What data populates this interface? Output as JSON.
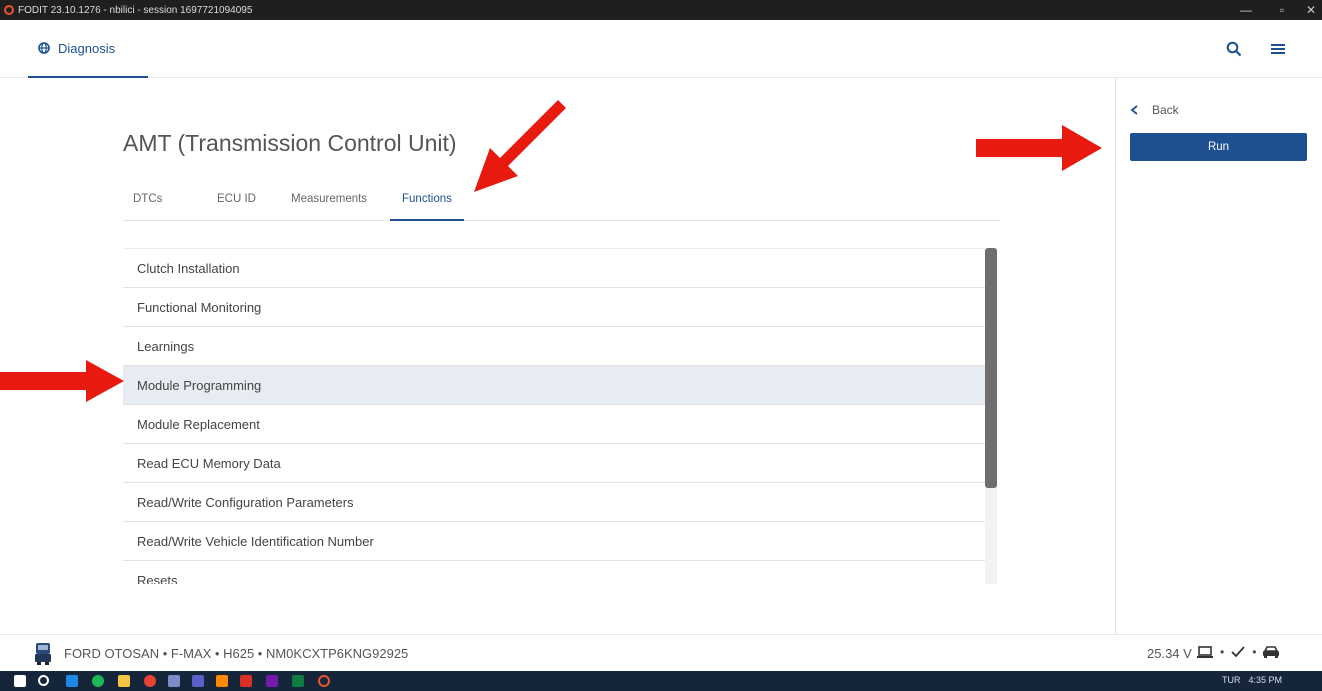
{
  "window": {
    "title": "FODIT 23.10.1276 - nbilici - session 1697721094095",
    "minimize": "—",
    "maximize": "▫",
    "close": "✕"
  },
  "header": {
    "nav_label": "Diagnosis",
    "nav_icon": "globe-icon",
    "search_icon": "search-icon",
    "menu_icon": "hamburger-menu-icon"
  },
  "main": {
    "page_title": "AMT (Transmission Control Unit)",
    "tabs": [
      {
        "label": "DTCs"
      },
      {
        "label": "ECU ID"
      },
      {
        "label": "Measurements"
      },
      {
        "label": "Functions",
        "active": true
      }
    ],
    "functions": [
      {
        "label": "Clutch Installation"
      },
      {
        "label": "Functional Monitoring"
      },
      {
        "label": "Learnings"
      },
      {
        "label": "Module Programming",
        "selected": true
      },
      {
        "label": "Module Replacement"
      },
      {
        "label": "Read ECU Memory Data"
      },
      {
        "label": "Read/Write Configuration Parameters"
      },
      {
        "label": "Read/Write Vehicle Identification Number"
      },
      {
        "label": "Resets"
      }
    ]
  },
  "side": {
    "back_label": "Back",
    "run_label": "Run"
  },
  "footer": {
    "vehicle": "FORD OTOSAN • F-MAX • H625 • NM0KCXTP6KNG92925",
    "voltage": "25.34 V",
    "sep": "•"
  },
  "taskbar": {
    "language": "TUR",
    "time": "4:35 PM"
  },
  "colors": {
    "accent": "#1d4f91",
    "selected_row": "#e7ecf2",
    "annotation_arrow": "#e8190f"
  }
}
